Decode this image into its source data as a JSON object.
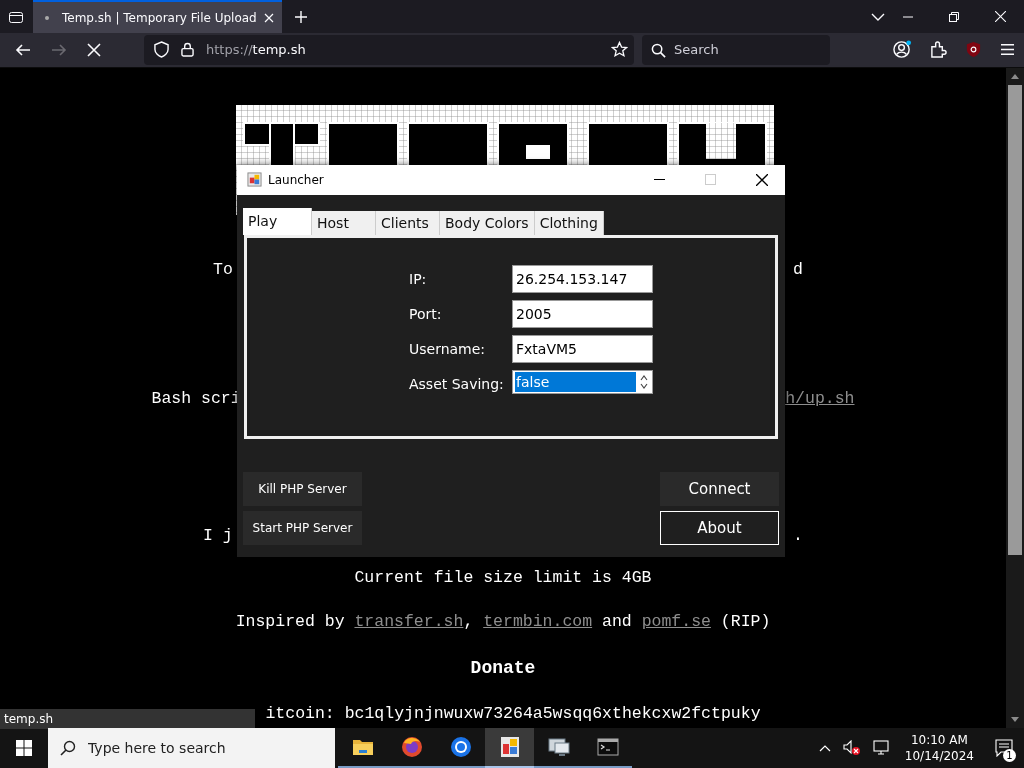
{
  "browser": {
    "tab_title": "Temp.sh | Temporary File Upload",
    "url_scheme": "https://",
    "url_host": "temp.sh",
    "search_placeholder": "Search",
    "forward_disabled": true
  },
  "page": {
    "line_1": {
      "left": "To",
      "right": "d"
    },
    "line_2": {
      "left": "Bash scri",
      "right_link": "h/up.sh"
    },
    "line_3": {
      "left": "I j",
      "right": "."
    },
    "size_limit": "Current file size limit is 4GB",
    "inspired": {
      "prefix": "Inspired by ",
      "links": [
        "transfer.sh",
        "termbin.com",
        "pomf.se"
      ],
      "separators": [
        ", ",
        " and "
      ],
      "suffix": " (RIP)"
    },
    "donate_heading": "Donate",
    "bitcoin": "itcoin: bc1qlyjnjnwuxw73264a5wsqq6xthekcxw2fctpuky"
  },
  "status_tooltip": "temp.sh",
  "dialog": {
    "title": "Launcher",
    "maximize_disabled": true,
    "tabs": [
      {
        "label": "Play",
        "selected": true
      },
      {
        "label": "Host",
        "selected": false
      },
      {
        "label": "Clients",
        "selected": false
      },
      {
        "label": "Body Colors",
        "selected": false
      },
      {
        "label": "Clothing",
        "selected": false
      }
    ],
    "fields": [
      {
        "label": "IP:",
        "value": "26.254.153.147",
        "kind": "text",
        "selected": false
      },
      {
        "label": "Port:",
        "value": "2005",
        "kind": "text",
        "selected": false
      },
      {
        "label": "Username:",
        "value": "FxtaVM5",
        "kind": "text",
        "selected": false
      },
      {
        "label": "Asset Saving:",
        "value": "false",
        "kind": "spin",
        "selected": true
      }
    ],
    "left_buttons": [
      {
        "label": "Kill PHP Server",
        "focused": false
      },
      {
        "label": "Start PHP Server",
        "focused": false
      }
    ],
    "right_buttons": [
      {
        "label": "Connect",
        "focused": false
      },
      {
        "label": "About",
        "focused": true
      }
    ]
  },
  "taskbar": {
    "search_placeholder": "Type here to search",
    "apps": [
      {
        "kind": "folder",
        "selected": false
      },
      {
        "kind": "firefox",
        "selected": false
      },
      {
        "kind": "browser",
        "selected": false
      },
      {
        "kind": "launcher",
        "selected": true
      },
      {
        "kind": "remote",
        "selected": false
      },
      {
        "kind": "terminal",
        "selected": false
      }
    ],
    "time": "10:10 AM",
    "date": "10/14/2024",
    "notification_count": "1"
  }
}
